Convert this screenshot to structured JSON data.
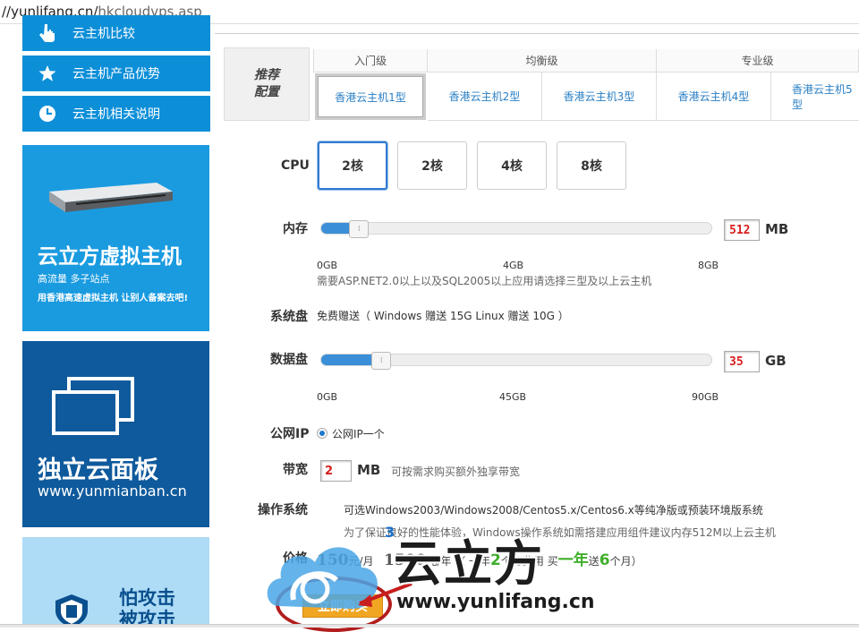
{
  "browser": {
    "url_host": "//yunlifang.cn/",
    "url_path": "hkcloudvps.asp"
  },
  "sidebar": {
    "items": [
      {
        "label": "云主机比较",
        "icon": "hand-pointer-icon"
      },
      {
        "label": "云主机产品优势",
        "icon": "star-icon"
      },
      {
        "label": "云主机相关说明",
        "icon": "clock-icon"
      }
    ]
  },
  "banners": {
    "vhost": {
      "title": "云立方虚拟主机",
      "subtitle": "高流量 多子站点",
      "tagline": "用香港高速虚拟主机 让别人备案去吧!"
    },
    "panel": {
      "title": "独立云面板",
      "url": "www.yunmianban.cn"
    },
    "attack": {
      "title": "怕攻击\n被攻击"
    }
  },
  "recommend": {
    "label_line1": "推荐",
    "label_line2": "配置",
    "grades": [
      "入门级",
      "均衡级",
      "专业级"
    ],
    "types": [
      "香港云主机1型",
      "香港云主机2型",
      "香港云主机3型",
      "香港云主机4型",
      "香港云主机5型"
    ],
    "selected_type": 0
  },
  "config": {
    "cpu": {
      "label": "CPU",
      "options": [
        "2核",
        "2核",
        "4核",
        "8核"
      ],
      "selected": 0
    },
    "memory": {
      "label": "内存",
      "value": "512",
      "unit": "MB",
      "level": 0.0625,
      "ticks": [
        "0GB",
        "4GB",
        "8GB"
      ],
      "note": "需要ASP.NET2.0以上以及SQL2005以上应用请选择三型及以上云主机"
    },
    "system_disk": {
      "label": "系统盘",
      "text": "免费赠送（ Windows 赠送 15G Linux 赠送 10G ）"
    },
    "data_disk": {
      "label": "数据盘",
      "value": "35",
      "unit": "GB",
      "level": 0.12,
      "ticks": [
        "0GB",
        "45GB",
        "90GB"
      ]
    },
    "public_ip": {
      "label": "公网IP",
      "option": "公网IP一个"
    },
    "bandwidth": {
      "label": "带宽",
      "value": "2",
      "unit": "MB",
      "note": "可按需求购买额外独享带宽"
    },
    "os": {
      "label": "操作系统",
      "text": "可选Windows2003/Windows2008/Centos5.x/Centos6.x等纯净版或预装环境版系统",
      "note": "为了保证良好的性能体验，Windows操作系统如需搭建应用组件建议内存512M以上云主机"
    },
    "price": {
      "label": "价格",
      "monthly": "150",
      "monthly_unit": "元/月",
      "yearly": "1500",
      "yearly_unit": "元/年",
      "pay_prefix": "（ 一年",
      "pay_years": "2",
      "pay_mid": "个月费用 买",
      "gift_years": "一年",
      "gift_mid": "送",
      "gift_months": "6",
      "gift_suffix": "个月）"
    },
    "buy_label": "立即购买"
  },
  "watermark": {
    "brand": "云立方",
    "url": "www.yunlifang.cn",
    "sup": "3"
  },
  "colors": {
    "sidebar_blue": "#0d8fd8",
    "selected_blue": "#2f7ad0",
    "value_red": "#d81e1e",
    "buy_orange": "#f0a623",
    "price_green": "#3fae2a"
  }
}
